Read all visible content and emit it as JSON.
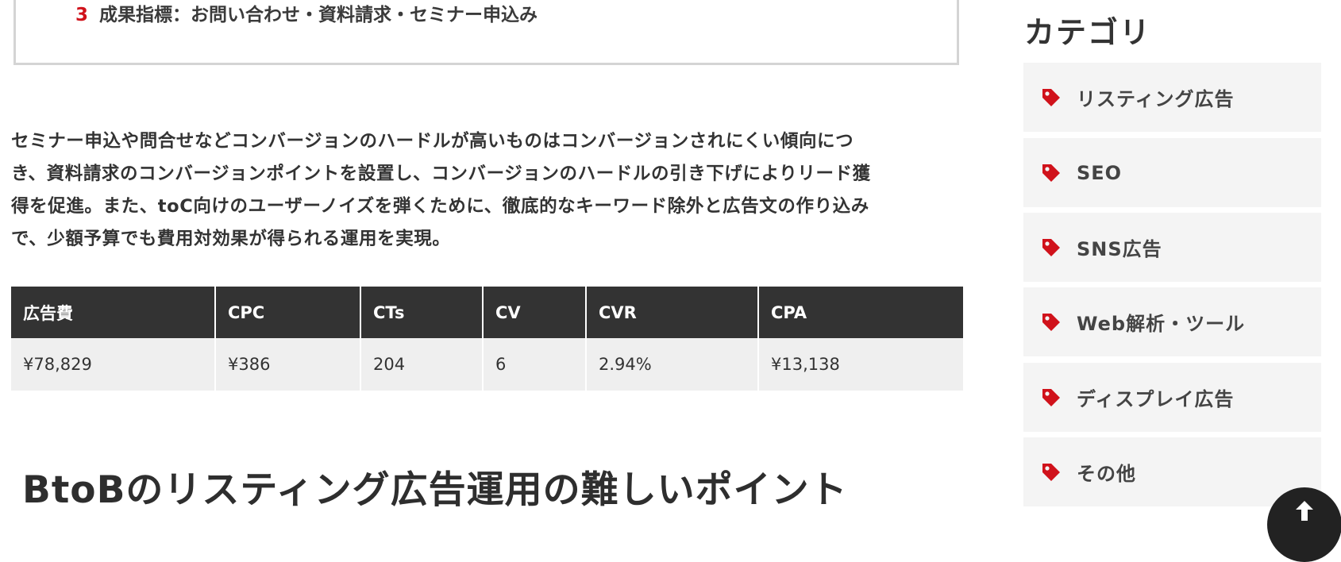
{
  "summary": {
    "item_number": "3",
    "item_text": "成果指標：お問い合わせ・資料請求・セミナー申込み"
  },
  "intro": {
    "lines": [
      "セミナー申込や問合せなどコンバージョンのハードルが高いものはコンバージョンされにくい傾向につ",
      "き、資料請求のコンバージョンポイントを設置し、コンバージョンのハードルの引き下げによりリード獲",
      "得を促進。また、toC向けのユーザーノイズを弾くために、徹底的なキーワード除外と広告文の作り込み",
      "で、少額予算でも費用対効果が得られる運用を実現。"
    ]
  },
  "results_table": {
    "headers": [
      "広告費",
      "CPC",
      "CTs",
      "CV",
      "CVR",
      "CPA"
    ],
    "rows": [
      [
        "¥78,829",
        "¥386",
        "204",
        "6",
        "2.94%",
        "¥13,138"
      ]
    ]
  },
  "section_heading": "BtoBのリスティング広告運用の難しいポイント",
  "sidebar": {
    "title": "カテゴリ",
    "categories": [
      {
        "label": "リスティング広告",
        "icon": "tag-icon"
      },
      {
        "label": "SEO",
        "icon": "tag-icon"
      },
      {
        "label": "SNS広告",
        "icon": "tag-icon"
      },
      {
        "label": "Web解析・ツール",
        "icon": "tag-icon"
      },
      {
        "label": "ディスプレイ広告",
        "icon": "tag-icon"
      },
      {
        "label": "その他",
        "icon": "tag-icon"
      }
    ]
  },
  "colors": {
    "accent_red": "#d0121b",
    "table_header_bg": "#333333",
    "table_cell_bg": "#efefef",
    "category_bg": "#f4f4f4",
    "back_to_top_bg": "#222222"
  },
  "back_to_top": {
    "icon": "arrow-up-icon"
  }
}
